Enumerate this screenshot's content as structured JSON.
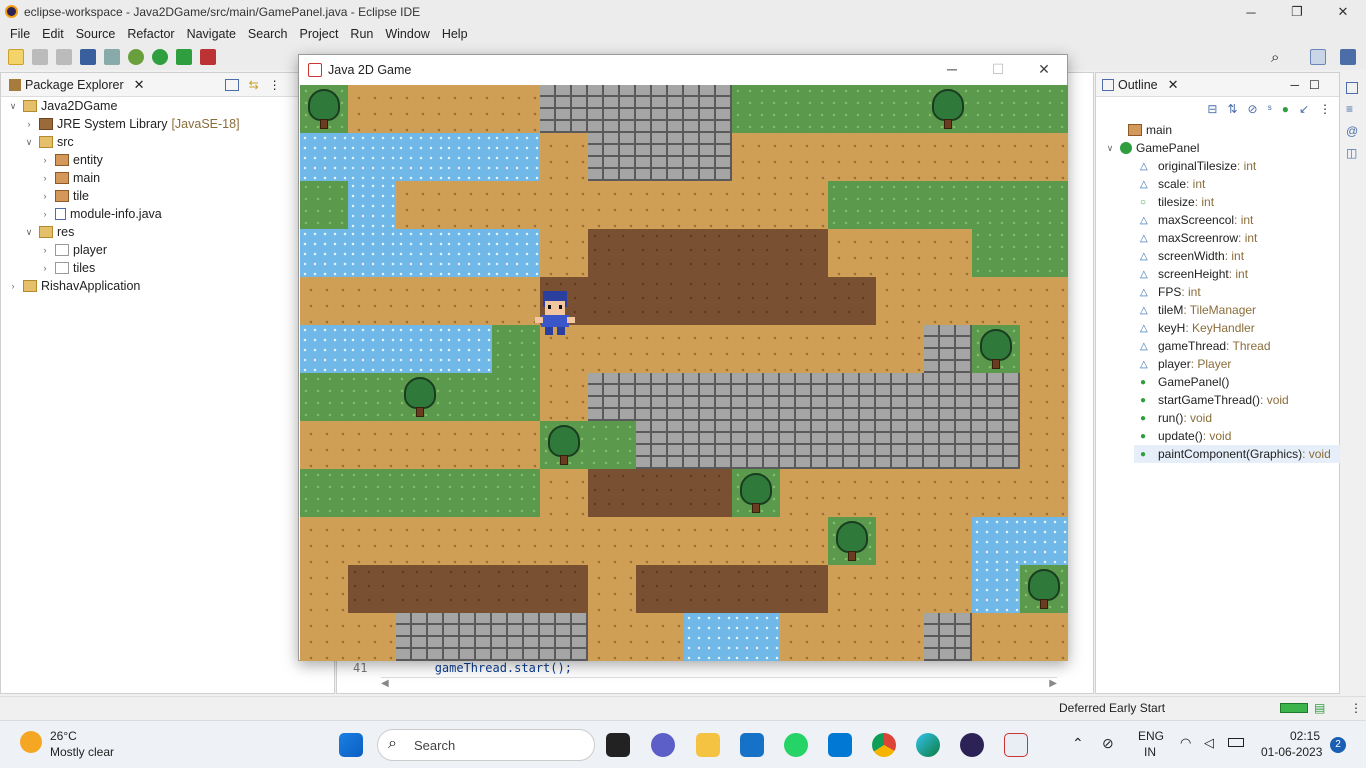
{
  "window": {
    "title": "eclipse-workspace - Java2DGame/src/main/GamePanel.java - Eclipse IDE"
  },
  "menu": [
    "File",
    "Edit",
    "Source",
    "Refactor",
    "Navigate",
    "Search",
    "Project",
    "Run",
    "Window",
    "Help"
  ],
  "package_explorer": {
    "tab": "Package Explorer",
    "items": [
      {
        "label": "Java2DGame",
        "suffix": "",
        "depth": 0,
        "twisty": "v"
      },
      {
        "label": "JRE System Library",
        "suffix": "[JavaSE-18]",
        "depth": 1,
        "twisty": ">"
      },
      {
        "label": "src",
        "suffix": "",
        "depth": 1,
        "twisty": "v"
      },
      {
        "label": "entity",
        "suffix": "",
        "depth": 2,
        "twisty": ">"
      },
      {
        "label": "main",
        "suffix": "",
        "depth": 2,
        "twisty": ">"
      },
      {
        "label": "tile",
        "suffix": "",
        "depth": 2,
        "twisty": ">"
      },
      {
        "label": "module-info.java",
        "suffix": "",
        "depth": 2,
        "twisty": ">"
      },
      {
        "label": "res",
        "suffix": "",
        "depth": 1,
        "twisty": "v"
      },
      {
        "label": "player",
        "suffix": "",
        "depth": 2,
        "twisty": ">"
      },
      {
        "label": "tiles",
        "suffix": "",
        "depth": 2,
        "twisty": ">"
      },
      {
        "label": "RishavApplication",
        "suffix": "",
        "depth": 0,
        "twisty": ">"
      }
    ]
  },
  "editor": {
    "line_no": "41",
    "code": "gameThread.start();"
  },
  "outline": {
    "tab": "Outline",
    "items": [
      {
        "name": "main",
        "type": "",
        "depth": 0
      },
      {
        "name": "GamePanel",
        "type": "",
        "depth": 0
      },
      {
        "name": "originalTilesize",
        "type": " : int",
        "depth": 1
      },
      {
        "name": "scale",
        "type": " : int",
        "depth": 1
      },
      {
        "name": "tilesize",
        "type": " : int",
        "depth": 1
      },
      {
        "name": "maxScreencol",
        "type": " : int",
        "depth": 1
      },
      {
        "name": "maxScreenrow",
        "type": " : int",
        "depth": 1
      },
      {
        "name": "screenWidth",
        "type": " : int",
        "depth": 1
      },
      {
        "name": "screenHeight",
        "type": " : int",
        "depth": 1
      },
      {
        "name": "FPS",
        "type": " : int",
        "depth": 1
      },
      {
        "name": "tileM",
        "type": " : TileManager",
        "depth": 1
      },
      {
        "name": "keyH",
        "type": " : KeyHandler",
        "depth": 1
      },
      {
        "name": "gameThread",
        "type": " : Thread",
        "depth": 1
      },
      {
        "name": "player",
        "type": " : Player",
        "depth": 1
      },
      {
        "name": "GamePanel()",
        "type": "",
        "depth": 1
      },
      {
        "name": "startGameThread()",
        "type": " : void",
        "depth": 1
      },
      {
        "name": "run()",
        "type": " : void",
        "depth": 1
      },
      {
        "name": "update()",
        "type": " : void",
        "depth": 1
      },
      {
        "name": "paintComponent(Graphics)",
        "type": " : void",
        "depth": 1
      }
    ]
  },
  "status": {
    "text": "Deferred Early Start"
  },
  "game_window": {
    "title": "Java 2D Game",
    "tile_legend": {
      "s": "sand",
      "g": "grass",
      "w": "water",
      "e": "earth",
      "r": "wall",
      "t": "tree"
    },
    "map": [
      "tssssrrrrggggtgg",
      "wwwwwsrrrsssssss",
      "gwsssssssssggggg",
      "wwwwwseeeeesssgg",
      "ssssseeeeeeessss",
      "wwwwgssssssssrts",
      "ggtggsrrrrrrrrrs",
      "ssssstgrrrrrrrrs",
      "gggggseeetssssss",
      "ssssssssssstssww",
      "seeeeeseeeessswt",
      "ssrrrrsswwsssrss"
    ]
  },
  "taskbar": {
    "weather_temp": "26°C",
    "weather_desc": "Mostly clear",
    "search_placeholder": "Search",
    "lang1": "ENG",
    "lang2": "IN",
    "time": "02:15",
    "date": "01-06-2023",
    "notifications": "2"
  }
}
